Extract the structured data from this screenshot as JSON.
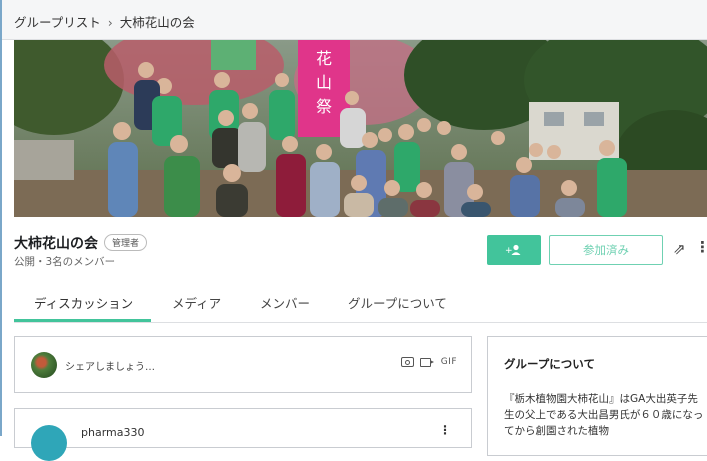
{
  "breadcrumb": {
    "root": "グループリスト",
    "separator": "›",
    "current": "大柿花山の会"
  },
  "cover": {
    "banner_text": "大柿花山祭"
  },
  "group": {
    "name": "大柿花山の会",
    "role_badge": "管理者",
    "meta": "公開・3名のメンバー"
  },
  "actions": {
    "add_member_icon": "add-person-icon",
    "joined_label": "参加済み",
    "share_icon": "share-arrow",
    "more_icon": "vertical-dots"
  },
  "tabs": [
    "ディスカッション",
    "メディア",
    "メンバー",
    "グループについて"
  ],
  "active_tab": 0,
  "composer": {
    "prompt": "シェアしましょう…",
    "gif_label": "GIF"
  },
  "post": {
    "author": "pharma330"
  },
  "about": {
    "heading": "グループについて",
    "text": "『栃木植物園大柿花山』はGA大出英子先生の父上である大出昌男氏が６０歳になってから創園された植物"
  },
  "colors": {
    "accent": "#42c49b",
    "accent_light": "#6fd1b2",
    "banner_pink": "#e0358a"
  }
}
